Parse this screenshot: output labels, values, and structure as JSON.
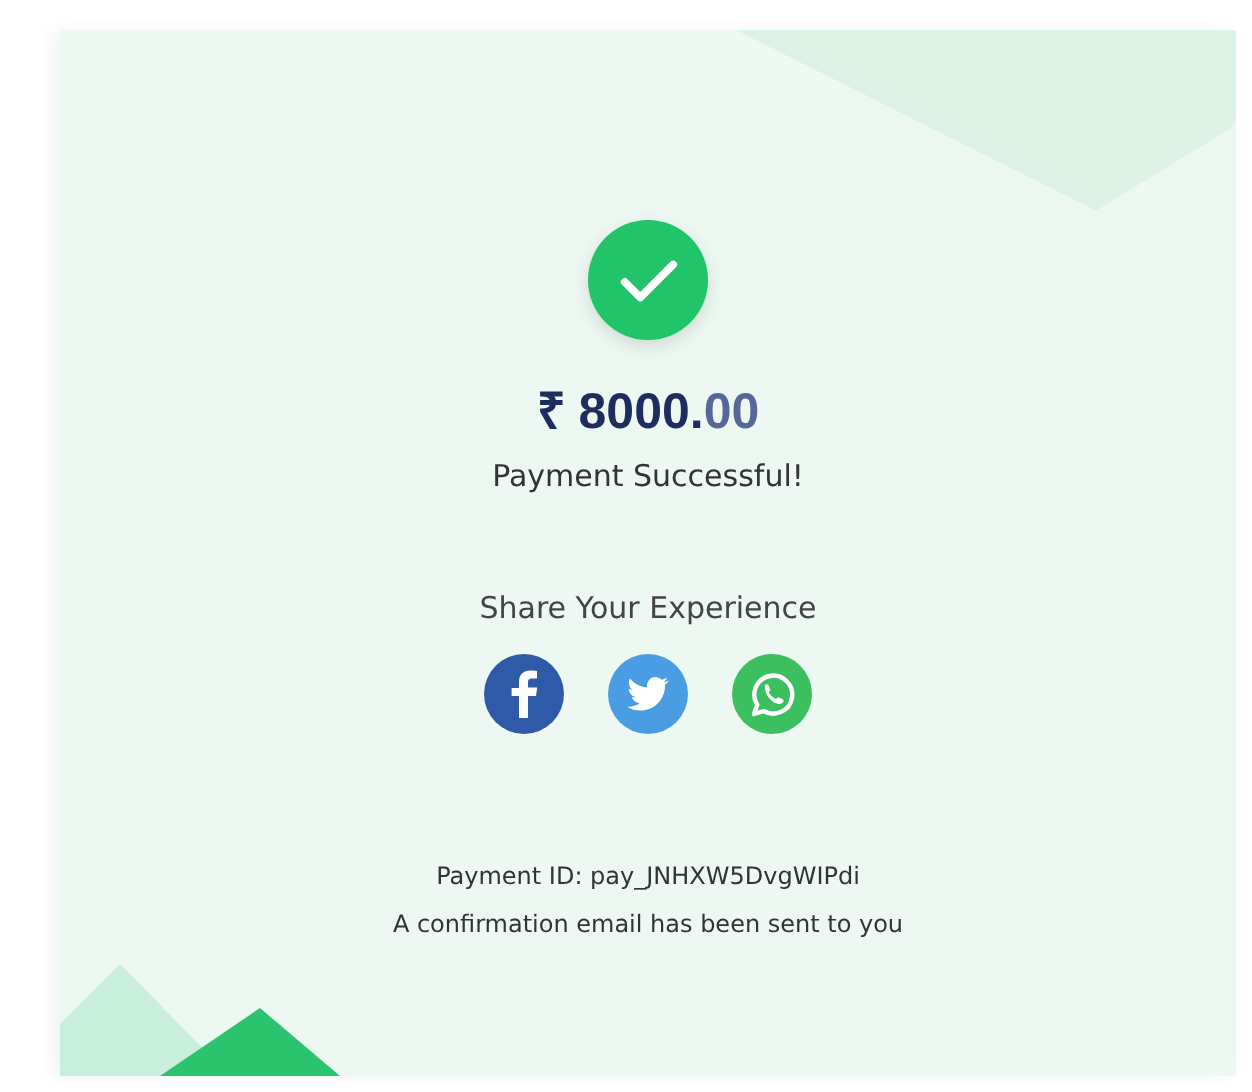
{
  "status": {
    "kind": "success"
  },
  "amount": {
    "whole": "₹ 8000.",
    "fraction": "00"
  },
  "message": "Payment Successful!",
  "share": {
    "title": "Share Your Experience",
    "buttons": [
      {
        "kind": "facebook"
      },
      {
        "kind": "twitter"
      },
      {
        "kind": "whatsapp"
      }
    ]
  },
  "payment_id": "Payment ID: pay_JNHXW5DvgWIPdi",
  "note": "A confirmation email has been sent to you"
}
